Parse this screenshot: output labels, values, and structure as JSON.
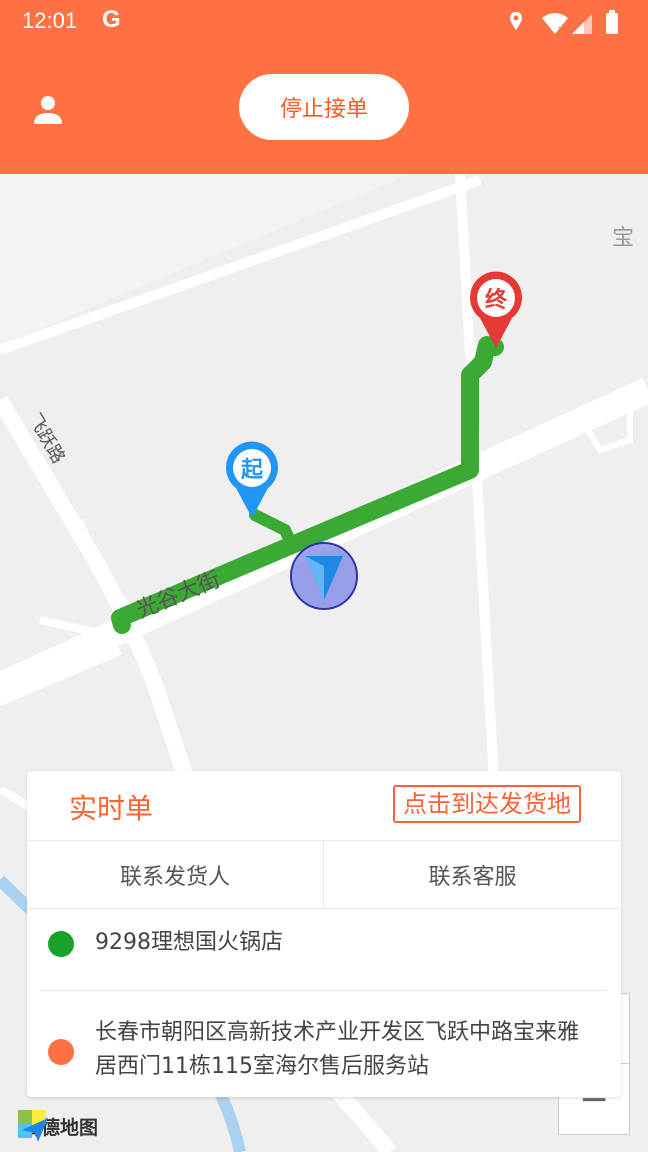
{
  "status_bar": {
    "time": "12:01",
    "app_icon": "G"
  },
  "header": {
    "stop_button_label": "停止接单"
  },
  "map": {
    "start_marker_label": "起",
    "end_marker_label": "终",
    "road_labels": [
      "光谷大街",
      "飞跃路",
      "宝"
    ],
    "zoom_in_label": "+",
    "zoom_out_label": "−",
    "provider_logo": "高德地图",
    "colors": {
      "route": "#3aaa35",
      "start": "#2196f3",
      "end": "#e53935"
    }
  },
  "order_card": {
    "title": "实时单",
    "action_label": "点击到达发货地",
    "contact_shipper_label": "联系发货人",
    "contact_service_label": "联系客服",
    "pickup": {
      "address": "9298理想国火锅店",
      "color": "#15a32a"
    },
    "dropoff": {
      "address": "长春市朝阳区高新技术产业开发区飞跃中路宝来雅居西门11栋115室海尔售后服务站",
      "color": "#ff7043"
    }
  }
}
